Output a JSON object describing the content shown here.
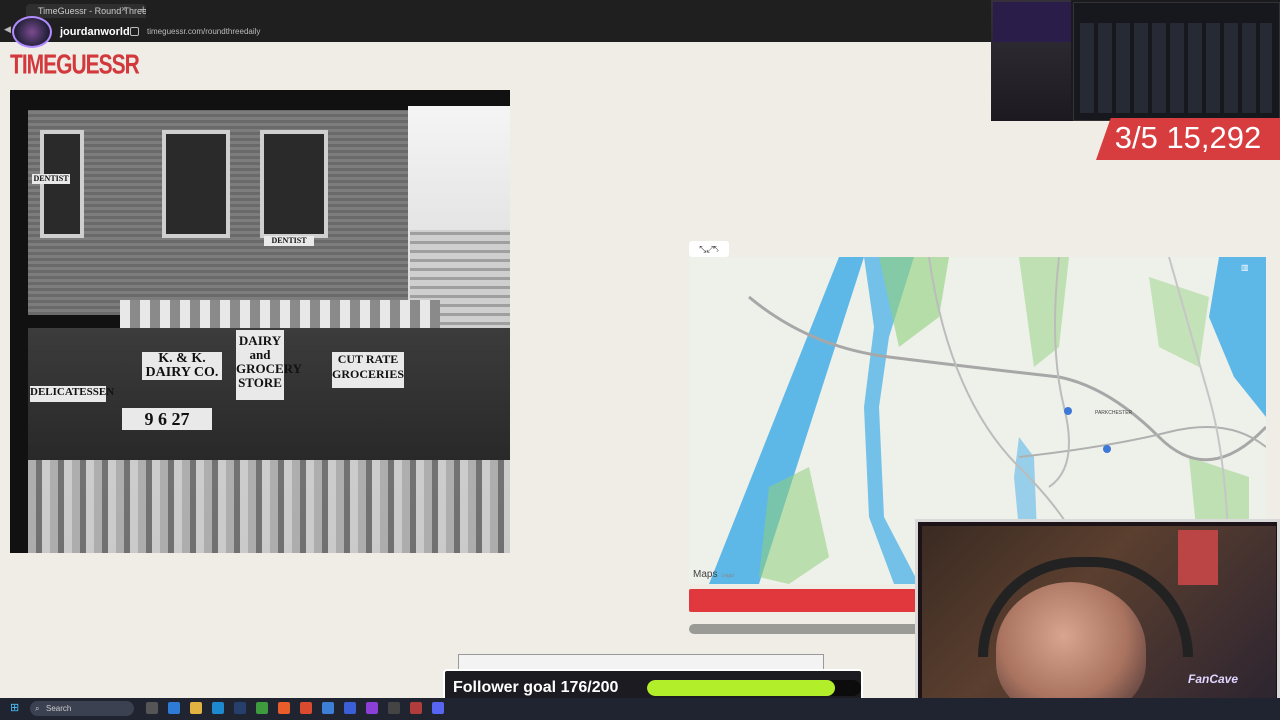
{
  "browser": {
    "tab_title": "TimeGuessr - Round Three",
    "tab_close": "×",
    "new_tab": "+",
    "url": "timeguessr.com/roundthreedaily"
  },
  "stream": {
    "channel_name": "jourdanworld",
    "score_text": "3/5 15,292",
    "follower_goal": "Follower goal 176/200",
    "follower_progress": 0.88,
    "fancave_text": "FanCave"
  },
  "game": {
    "logo": "TIMEGUESSR",
    "photo_signs": {
      "dentist1": "DENTIST",
      "dentist2": "DENTIST",
      "dairy": "DAIRY and GROCERY STORE",
      "kk": "K. & K. DAIRY CO.",
      "cutrate": "CUT RATE GROCERIES",
      "delicatessen": "DELICATESSEN",
      "prices": "9 6 27"
    },
    "map": {
      "place_label": "PARKCHESTER",
      "brand": "Maps",
      "legal": "Legal",
      "tools": "⤡⤢⤣"
    }
  },
  "taskbar": {
    "search_placeholder": "Search"
  },
  "colors": {
    "accent": "#d73d3f",
    "goal_fill": "#b3ee2a",
    "water": "#5db8e8",
    "park": "#8fd07a"
  }
}
